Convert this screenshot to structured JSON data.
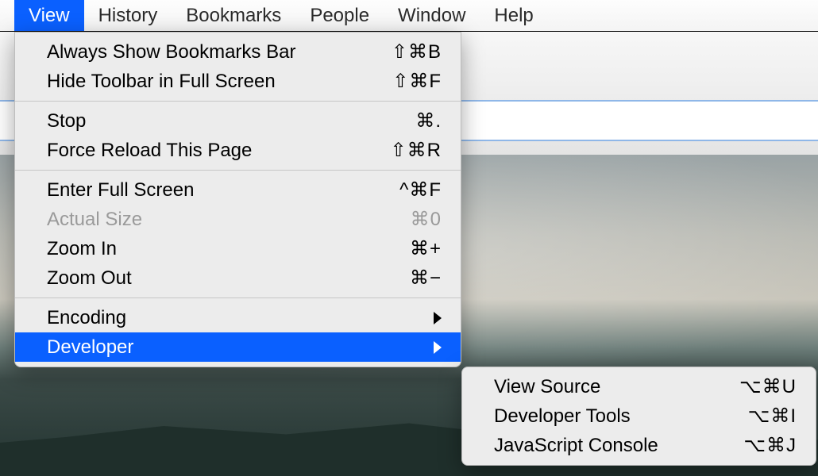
{
  "menubar": {
    "items": [
      {
        "label": "View",
        "selected": true
      },
      {
        "label": "History",
        "selected": false
      },
      {
        "label": "Bookmarks",
        "selected": false
      },
      {
        "label": "People",
        "selected": false
      },
      {
        "label": "Window",
        "selected": false
      },
      {
        "label": "Help",
        "selected": false
      }
    ]
  },
  "view_menu": {
    "groups": [
      [
        {
          "label": "Always Show Bookmarks Bar",
          "shortcut": "⇧⌘B"
        },
        {
          "label": "Hide Toolbar in Full Screen",
          "shortcut": "⇧⌘F"
        }
      ],
      [
        {
          "label": "Stop",
          "shortcut": "⌘."
        },
        {
          "label": "Force Reload This Page",
          "shortcut": "⇧⌘R"
        }
      ],
      [
        {
          "label": "Enter Full Screen",
          "shortcut": "^⌘F"
        },
        {
          "label": "Actual Size",
          "shortcut": "⌘0",
          "disabled": true
        },
        {
          "label": "Zoom In",
          "shortcut": "⌘+"
        },
        {
          "label": "Zoom Out",
          "shortcut": "⌘−"
        }
      ],
      [
        {
          "label": "Encoding",
          "submenu": true
        },
        {
          "label": "Developer",
          "submenu": true,
          "highlighted": true
        }
      ]
    ]
  },
  "developer_submenu": {
    "items": [
      {
        "label": "View Source",
        "shortcut": "⌥⌘U"
      },
      {
        "label": "Developer Tools",
        "shortcut": "⌥⌘I"
      },
      {
        "label": "JavaScript Console",
        "shortcut": "⌥⌘J"
      }
    ]
  }
}
